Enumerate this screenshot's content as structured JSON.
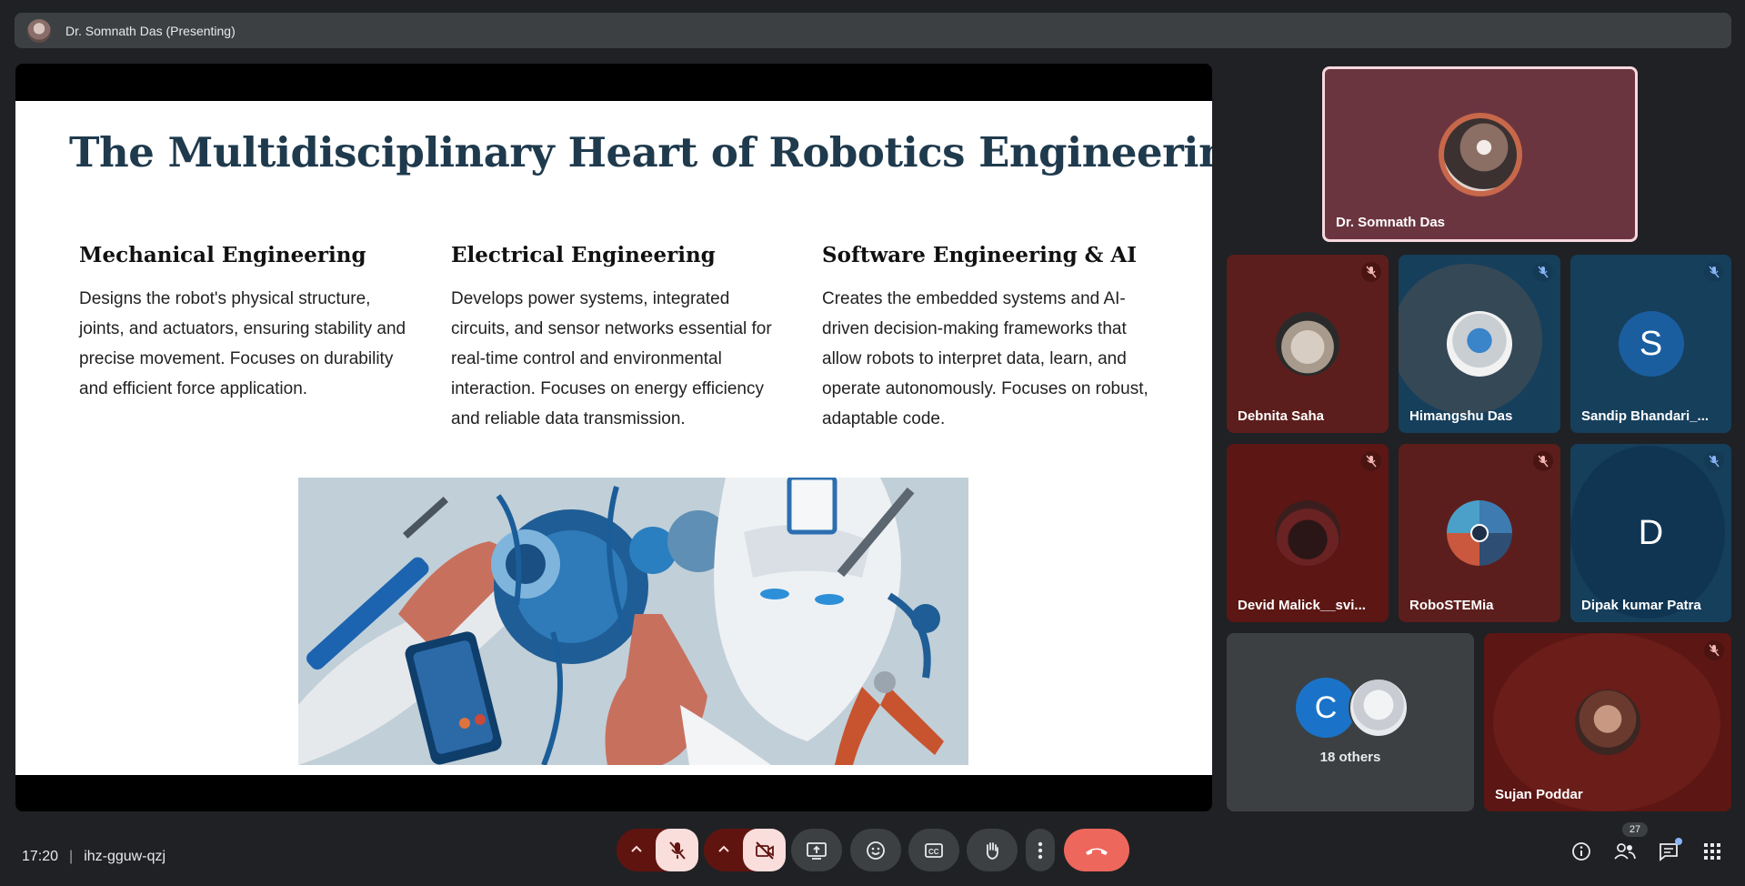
{
  "presenter_bar": {
    "label": "Dr. Somnath Das (Presenting)"
  },
  "slide": {
    "title": "The Multidisciplinary Heart of Robotics Engineering",
    "columns": [
      {
        "heading": "Mechanical Engineering",
        "body": "Designs the robot's physical structure, joints, and actuators, ensuring stability and precise movement. Focuses on durability and efficient force application."
      },
      {
        "heading": "Electrical Engineering",
        "body": "Develops power systems, integrated circuits, and sensor networks essential for real-time control and environmental interaction. Focuses on energy efficiency and reliable data transmission."
      },
      {
        "heading": "Software Engineering & AI",
        "body": "Creates the embedded systems and AI-driven decision-making frameworks that allow robots to interpret data, learn, and operate autonomously. Focuses on robust, adaptable code."
      }
    ]
  },
  "participants": {
    "speaker": {
      "name": "Dr. Somnath Das"
    },
    "tiles": [
      {
        "name": "Debnita Saha"
      },
      {
        "name": "Himangshu Das"
      },
      {
        "name": "Sandip Bhandari_...",
        "initial": "S"
      },
      {
        "name": "Devid Malick__svi..."
      },
      {
        "name": "RoboSTEMia"
      },
      {
        "name": "Dipak kumar Patra",
        "initial": "D"
      },
      {
        "name": "Sujan Poddar"
      }
    ],
    "others": {
      "label": "18 others",
      "initial": "C"
    }
  },
  "meeting": {
    "time": "17:20",
    "separator": "|",
    "code": "ihz-gguw-qzj"
  },
  "right_controls": {
    "people_count": "27"
  },
  "colors": {
    "end_call": "#ee675c",
    "muted_bg": "#f9dedc",
    "muted_pill": "#601410"
  }
}
